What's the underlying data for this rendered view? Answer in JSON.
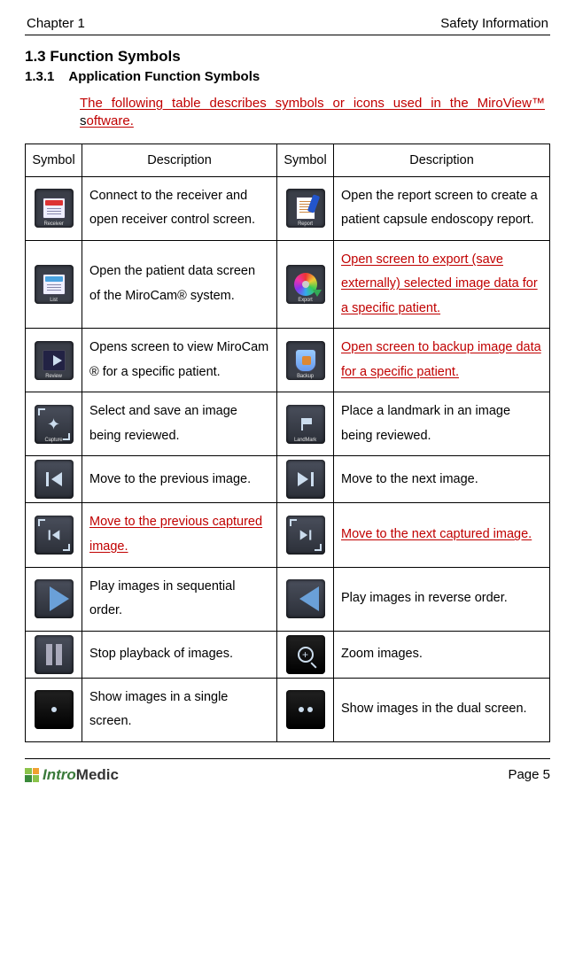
{
  "header": {
    "chapter": "Chapter 1",
    "title": "Safety Information"
  },
  "section": {
    "number_title": "1.3 Function Symbols",
    "sub_number": "1.3.1",
    "sub_title": "Application Function Symbols",
    "intro_pre": "The following table describes symbols or icons used in the MiroView™ ",
    "intro_s": "s",
    "intro_post": "oftware."
  },
  "table_headers": {
    "symbol": "Symbol",
    "description": "Description"
  },
  "rows": [
    {
      "l_icon_cap": "Receiver",
      "l_desc": "Connect to the receiver and open receiver control screen.",
      "r_icon_cap": "Report",
      "r_desc": "Open the report screen to create a patient capsule endoscopy report."
    },
    {
      "l_icon_cap": "List",
      "l_desc": "Open the patient data screen of the MiroCam® system.",
      "r_icon_cap": "Export",
      "r_desc": "Open screen to export (save externally) selected image data for a specific patient.",
      "r_rev": true
    },
    {
      "l_icon_cap": "Review",
      "l_desc": "Opens screen to view MiroCam ® for a specific patient.",
      "r_icon_cap": "Backup",
      "r_desc": "Open screen to backup image data for a specific patient.",
      "r_rev": true
    },
    {
      "l_icon_cap": "Capture",
      "l_desc": "Select and save an image being reviewed.",
      "r_icon_cap": "LandMark",
      "r_desc": "Place a landmark in an image being reviewed."
    },
    {
      "l_desc": "Move to the previous image.",
      "r_desc": "Move to the next image."
    },
    {
      "l_desc": "Move to the previous captured image.",
      "l_rev": true,
      "r_desc": "Move to the next captured image.",
      "r_rev": true
    },
    {
      "l_desc": "Play images in sequential order.",
      "r_desc": "Play images in reverse order."
    },
    {
      "l_desc": "Stop playback of images.",
      "r_desc": "Zoom images."
    },
    {
      "l_desc": "Show images in a single screen.",
      "r_desc": "Show images in the dual screen."
    }
  ],
  "footer": {
    "brand1": "Intro",
    "brand2": "Medic",
    "page": "Page 5"
  }
}
